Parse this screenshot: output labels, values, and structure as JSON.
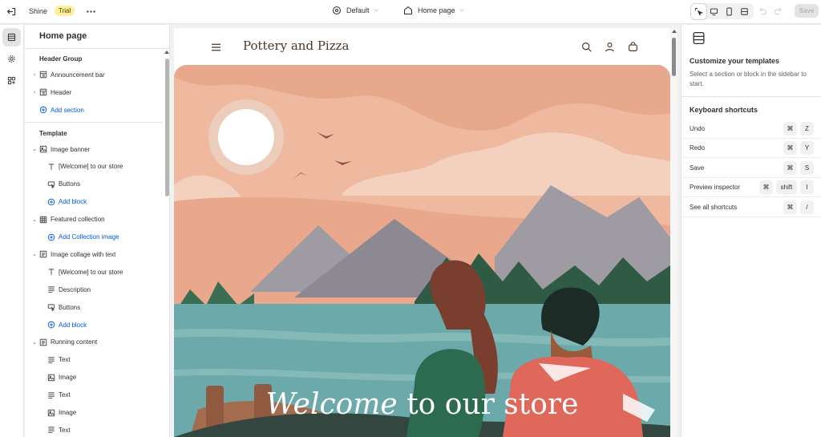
{
  "topbar": {
    "store_name": "Shine",
    "badge": "Trial",
    "theme": "Default",
    "page": "Home page",
    "save_label": "Save"
  },
  "sidebar": {
    "title": "Home page",
    "header_group_label": "Header Group",
    "header_items": [
      "Announcement bar",
      "Header"
    ],
    "add_section": "Add section",
    "template_label": "Template",
    "tree": [
      {
        "label": "Image banner",
        "kind": "section",
        "icon": "banner-icon"
      },
      {
        "label": "[Welcome] to our store",
        "kind": "block",
        "icon": "text-icon"
      },
      {
        "label": "Buttons",
        "kind": "block",
        "icon": "button-icon"
      },
      {
        "label": "Add block",
        "kind": "add"
      },
      {
        "label": "Featured collection",
        "kind": "section",
        "icon": "grid-icon"
      },
      {
        "label": "Add Collection image",
        "kind": "add"
      },
      {
        "label": "Image collage with text",
        "kind": "section",
        "icon": "collage-icon"
      },
      {
        "label": "[Welcome] to our store",
        "kind": "block",
        "icon": "text-icon"
      },
      {
        "label": "Description",
        "kind": "block",
        "icon": "paragraph-icon"
      },
      {
        "label": "Buttons",
        "kind": "block",
        "icon": "button-icon"
      },
      {
        "label": "Add block",
        "kind": "add"
      },
      {
        "label": "Running content",
        "kind": "section",
        "icon": "collage-icon"
      },
      {
        "label": "Text",
        "kind": "block",
        "icon": "paragraph-icon"
      },
      {
        "label": "Image",
        "kind": "block",
        "icon": "image-icon"
      },
      {
        "label": "Text",
        "kind": "block",
        "icon": "paragraph-icon"
      },
      {
        "label": "Image",
        "kind": "block",
        "icon": "image-icon"
      },
      {
        "label": "Text",
        "kind": "block",
        "icon": "paragraph-icon"
      }
    ]
  },
  "preview": {
    "store_logo": "Pottery and Pizza",
    "hero_heading_italic": "Welcome",
    "hero_heading_rest": " to our store"
  },
  "right_panel": {
    "title": "Customize your templates",
    "description": "Select a section or block in the sidebar to start.",
    "shortcuts_title": "Keyboard shortcuts",
    "shortcuts": [
      {
        "label": "Undo",
        "keys": [
          "⌘",
          "Z"
        ]
      },
      {
        "label": "Redo",
        "keys": [
          "⌘",
          "Y"
        ]
      },
      {
        "label": "Save",
        "keys": [
          "⌘",
          "S"
        ]
      },
      {
        "label": "Preview inspector",
        "keys": [
          "⌘",
          "shift",
          "I"
        ]
      },
      {
        "label": "See all shortcuts",
        "keys": [
          "⌘",
          "/"
        ]
      }
    ]
  },
  "colors": {
    "accent": "#005bd3",
    "badge_bg": "#ffef9d",
    "hero_sky": "#efb9a0"
  }
}
